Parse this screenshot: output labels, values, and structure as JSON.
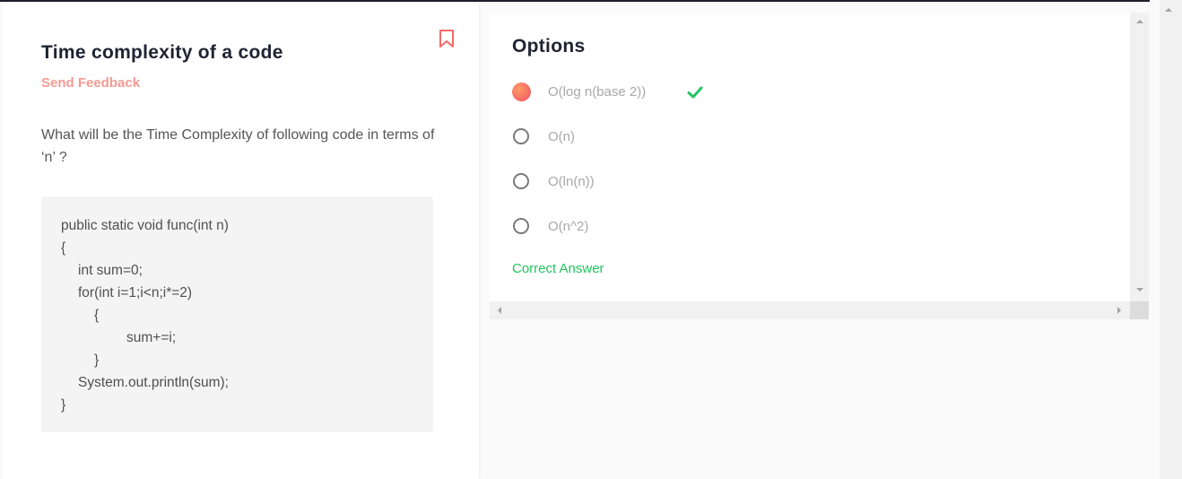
{
  "question": {
    "title": "Time complexity of a code",
    "feedback_label": "Send Feedback",
    "text": "What will be the Time Complexity of following code in terms of ‘n’ ?",
    "code_lines": [
      "public static void func(int n)",
      "{",
      "int sum=0;",
      "for(int i=1;i<n;i*=2)",
      "{",
      "sum+=i;",
      "}",
      "System.out.println(sum);",
      "}"
    ]
  },
  "options": {
    "title": "Options",
    "items": [
      {
        "label": "O(log n(base 2))",
        "selected": true,
        "correct": true
      },
      {
        "label": "O(n)",
        "selected": false,
        "correct": false
      },
      {
        "label": "O(ln(n))",
        "selected": false,
        "correct": false
      },
      {
        "label": "O(n^2)",
        "selected": false,
        "correct": false
      }
    ],
    "result_text": "Correct Answer"
  },
  "icons": {
    "bookmark": "bookmark-icon",
    "check": "checkmark-icon",
    "radio": "radio-button-icon"
  },
  "colors": {
    "accent_text": "#f59a93",
    "correct": "#22c55e",
    "selected_radio": "#f26767",
    "heading": "#1f2332"
  }
}
